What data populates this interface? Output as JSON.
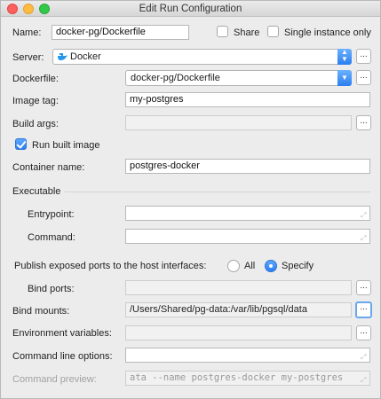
{
  "window": {
    "title": "Edit Run Configuration"
  },
  "name_row": {
    "label": "Name:",
    "value": "docker-pg/Dockerfile",
    "share_label": "Share",
    "single_instance_label": "Single instance only"
  },
  "server": {
    "label": "Server:",
    "value": "Docker"
  },
  "dockerfile": {
    "label": "Dockerfile:",
    "value": "docker-pg/Dockerfile"
  },
  "image_tag": {
    "label": "Image tag:",
    "value": "my-postgres"
  },
  "build_args": {
    "label": "Build args:",
    "value": ""
  },
  "run_built_image": {
    "label": "Run built image",
    "checked": true
  },
  "container_name": {
    "label": "Container name:",
    "value": "postgres-docker"
  },
  "executable": {
    "label": "Executable"
  },
  "entrypoint": {
    "label": "Entrypoint:",
    "value": ""
  },
  "command": {
    "label": "Command:",
    "value": ""
  },
  "publish": {
    "label": "Publish exposed ports to the host interfaces:",
    "option_all": "All",
    "option_specify": "Specify",
    "selected": "Specify"
  },
  "bind_ports": {
    "label": "Bind ports:",
    "value": ""
  },
  "bind_mounts": {
    "label": "Bind mounts:",
    "value": "/Users/Shared/pg-data:/var/lib/pgsql/data"
  },
  "env_vars": {
    "label": "Environment variables:",
    "value": ""
  },
  "cmd_options": {
    "label": "Command line options:",
    "value": ""
  },
  "cmd_preview": {
    "label": "Command preview:",
    "value": "ata --name postgres-docker my-postgres"
  },
  "ellipsis": "...",
  "colors": {
    "accent": "#2b7ef2",
    "focus_ring": "#6aa7ee",
    "docker_blue": "#2496ed"
  },
  "icons": {
    "dropdown": "chevron-updown-icon",
    "expand": "expand-icon",
    "docker": "docker-whale-icon"
  }
}
